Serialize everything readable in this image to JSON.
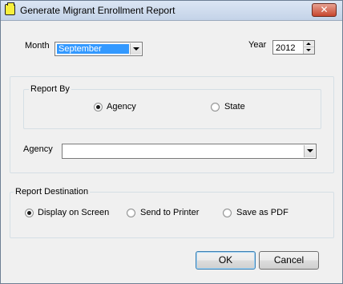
{
  "window": {
    "title": "Generate Migrant Enrollment Report",
    "close_symbol": "✕"
  },
  "month": {
    "label": "Month",
    "value": "September"
  },
  "year": {
    "label": "Year",
    "value": "2012"
  },
  "report_by": {
    "legend": "Report By",
    "options": [
      "Agency",
      "State"
    ],
    "selected": "Agency"
  },
  "agency": {
    "label": "Agency",
    "value": ""
  },
  "report_destination": {
    "legend": "Report Destination",
    "options": [
      "Display on Screen",
      "Send to Printer",
      "Save as PDF"
    ],
    "selected": "Display on Screen"
  },
  "buttons": {
    "ok": "OK",
    "cancel": "Cancel"
  },
  "colors": {
    "titlebar": "#c4d3e8",
    "close_button": "#c7462f",
    "selection": "#3399ff"
  }
}
